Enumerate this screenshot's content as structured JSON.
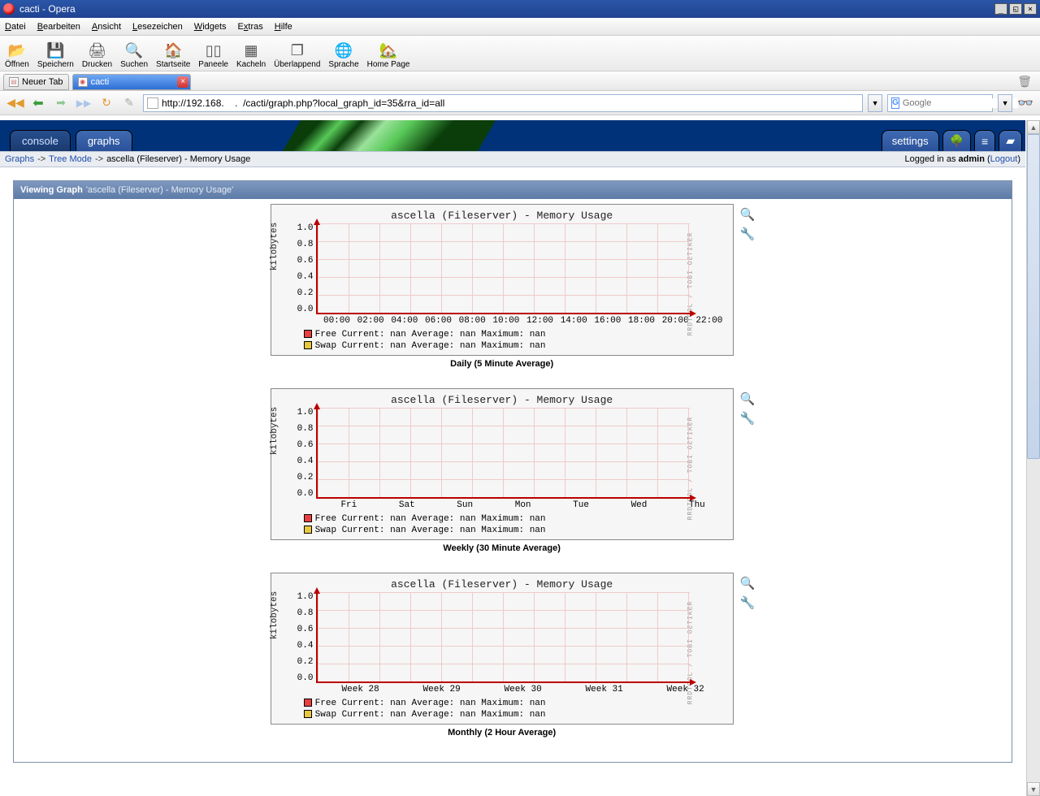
{
  "window": {
    "title": "cacti - Opera"
  },
  "menubar": [
    "Datei",
    "Bearbeiten",
    "Ansicht",
    "Lesezeichen",
    "Widgets",
    "Extras",
    "Hilfe"
  ],
  "toolbar": [
    {
      "icon": "folder",
      "glyph": "📂",
      "label": "Öffnen"
    },
    {
      "icon": "floppy",
      "glyph": "💾",
      "label": "Speichern"
    },
    {
      "icon": "printer",
      "glyph": "🖨",
      "label": "Drucken"
    },
    {
      "icon": "mag",
      "glyph": "🔍",
      "label": "Suchen"
    },
    {
      "icon": "home",
      "glyph": "🏠",
      "label": "Startseite"
    },
    {
      "icon": "tile",
      "glyph": "▯▯",
      "label": "Paneele"
    },
    {
      "icon": "tile",
      "glyph": "▦",
      "label": "Kacheln"
    },
    {
      "icon": "tile",
      "glyph": "❐",
      "label": "Überlappend"
    },
    {
      "icon": "globe",
      "glyph": "🌐",
      "label": "Sprache"
    },
    {
      "icon": "home",
      "glyph": "🏡",
      "label": "Home Page"
    }
  ],
  "tabs": {
    "new_tab": "Neuer Tab",
    "active": "cacti"
  },
  "address": {
    "url": "http://192.168.    .  /cacti/graph.php?local_graph_id=35&rra_id=all"
  },
  "searchbox": {
    "placeholder": "Google"
  },
  "cacti_tabs": {
    "left": [
      "console",
      "graphs"
    ],
    "right_label": "settings"
  },
  "breadcrumb": {
    "graphs": "Graphs",
    "tree": "Tree Mode",
    "leaf": "ascella (Fileserver) - Memory Usage",
    "logged_in": "Logged in as",
    "user": "admin",
    "logout": "Logout"
  },
  "panel": {
    "prefix": "Viewing Graph",
    "suffix": "'ascella (Fileserver) - Memory Usage'"
  },
  "rrdtool": "RRDTOOL / TOBI OETIKER",
  "chart_data": [
    {
      "type": "line",
      "title": "ascella (Fileserver) - Memory Usage",
      "ylabel": "kilobytes",
      "yticks": [
        "1.0",
        "0.8",
        "0.6",
        "0.4",
        "0.2",
        "0.0"
      ],
      "xticks": [
        "00:00",
        "02:00",
        "04:00",
        "06:00",
        "08:00",
        "10:00",
        "12:00",
        "14:00",
        "16:00",
        "18:00",
        "20:00",
        "22:00"
      ],
      "ylim": [
        0,
        1.0
      ],
      "series": [
        {
          "name": "Free",
          "color": "#e84040",
          "values": null
        },
        {
          "name": "Swap",
          "color": "#e8c840",
          "values": null
        }
      ],
      "legend_lines": [
        "Free   Current:     nan    Average:     nan    Maximum:     nan",
        "Swap   Current:     nan    Average:     nan    Maximum:     nan"
      ],
      "caption": "Daily (5 Minute Average)"
    },
    {
      "type": "line",
      "title": "ascella (Fileserver) - Memory Usage",
      "ylabel": "kilobytes",
      "yticks": [
        "1.0",
        "0.8",
        "0.6",
        "0.4",
        "0.2",
        "0.0"
      ],
      "xticks": [
        "Fri",
        "Sat",
        "Sun",
        "Mon",
        "Tue",
        "Wed",
        "Thu"
      ],
      "ylim": [
        0,
        1.0
      ],
      "series": [
        {
          "name": "Free",
          "color": "#e84040",
          "values": null
        },
        {
          "name": "Swap",
          "color": "#e8c840",
          "values": null
        }
      ],
      "legend_lines": [
        "Free   Current:     nan    Average:     nan    Maximum:     nan",
        "Swap   Current:     nan    Average:     nan    Maximum:     nan"
      ],
      "caption": "Weekly (30 Minute Average)"
    },
    {
      "type": "line",
      "title": "ascella (Fileserver) - Memory Usage",
      "ylabel": "kilobytes",
      "yticks": [
        "1.0",
        "0.8",
        "0.6",
        "0.4",
        "0.2",
        "0.0"
      ],
      "xticks": [
        "Week 28",
        "Week 29",
        "Week 30",
        "Week 31",
        "Week 32"
      ],
      "ylim": [
        0,
        1.0
      ],
      "series": [
        {
          "name": "Free",
          "color": "#e84040",
          "values": null
        },
        {
          "name": "Swap",
          "color": "#e8c840",
          "values": null
        }
      ],
      "legend_lines": [
        "Free   Current:     nan    Average:     nan    Maximum:     nan",
        "Swap   Current:     nan    Average:     nan    Maximum:     nan"
      ],
      "caption": "Monthly (2 Hour Average)"
    }
  ]
}
